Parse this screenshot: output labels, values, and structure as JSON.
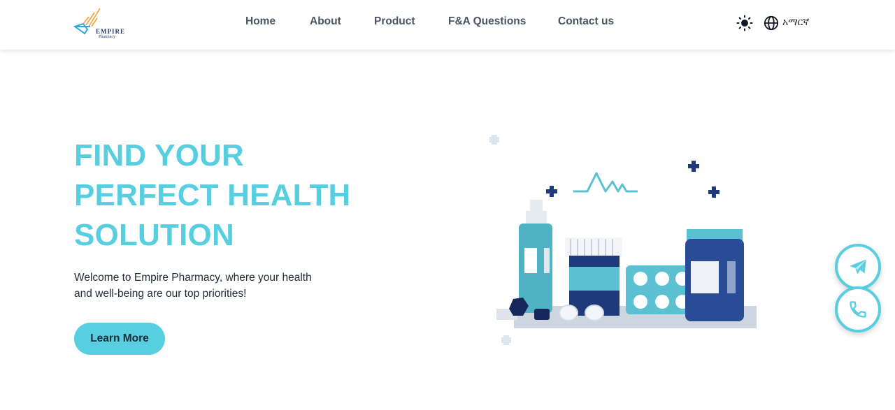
{
  "brand": {
    "name": "EMPIRE",
    "subtitle": "Pharmacy",
    "colors": {
      "accent": "#58cfe0",
      "navy": "#1f3a6e",
      "logo_orange": "#f2a23a"
    }
  },
  "nav": {
    "items": [
      {
        "label": "Home"
      },
      {
        "label": "About"
      },
      {
        "label": "Product"
      },
      {
        "label": "F&A Questions"
      },
      {
        "label": "Contact us"
      }
    ]
  },
  "header_actions": {
    "theme_icon": "sun-icon",
    "language_icon": "globe-icon",
    "language_label": "አማርኛ"
  },
  "hero": {
    "title_lines": [
      "FIND YOUR",
      "PERFECT HEALTH",
      "SOLUTION"
    ],
    "description_lines": [
      "Welcome to Empire Pharmacy, where your health",
      "and well-being are our top priorities!"
    ],
    "cta_label": "Learn More"
  },
  "floating_actions": {
    "telegram_icon": "telegram-icon",
    "phone_icon": "phone-icon"
  }
}
